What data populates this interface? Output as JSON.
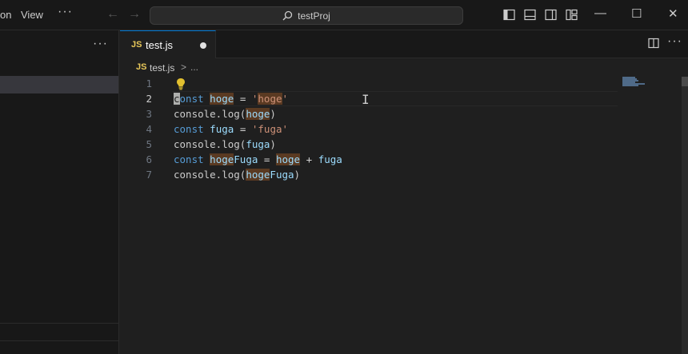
{
  "menu": {
    "partial_item": "on",
    "view": "View",
    "more": "···"
  },
  "search": {
    "text": "testProj",
    "icon": "search-icon"
  },
  "tabs": [
    {
      "label": "test.js",
      "badge": "JS",
      "dirty": true
    }
  ],
  "breadcrumb": {
    "badge": "JS",
    "file": "test.js",
    "separator": ">",
    "ellipsis": "..."
  },
  "sidebar": {
    "more": "···"
  },
  "window_controls": {
    "minimize": "—",
    "maximize": "☐",
    "close": "✕"
  },
  "editor": {
    "active_line": 2,
    "line_numbers": [
      "1",
      "2",
      "3",
      "4",
      "5",
      "6",
      "7"
    ]
  },
  "colors": {
    "accent": "#0078d4",
    "keyword": "#569cd6",
    "variable": "#9cdcfe",
    "string": "#ce9178",
    "highlight": "#5a3a22"
  }
}
